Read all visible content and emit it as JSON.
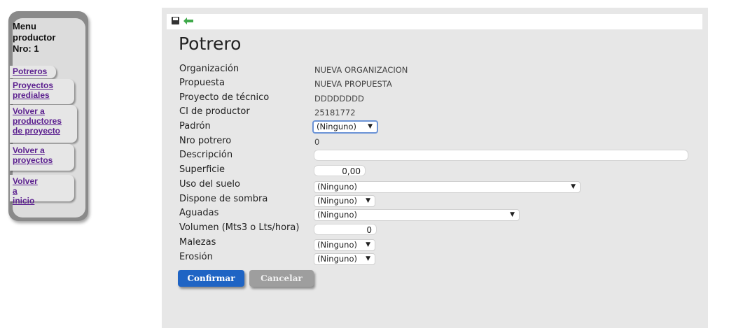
{
  "menu": {
    "title_line1": "Menu",
    "title_line2": "productor",
    "title_line3": "Nro: 1",
    "items": [
      {
        "line1": "Potreros",
        "line2": "",
        "line3": ""
      },
      {
        "line1": "Proyectos",
        "line2": "prediales",
        "line3": ""
      },
      {
        "line1": "Volver a",
        "line2": "productores",
        "line3": "de proyecto"
      },
      {
        "line1": "Volver a",
        "line2": "proyectos",
        "line3": ""
      },
      {
        "line1": "Volver a",
        "line2": "inicio",
        "line3": ""
      }
    ]
  },
  "toolbar": {
    "icons": [
      "save-icon",
      "back-arrow-icon"
    ]
  },
  "page": {
    "title": "Potrero"
  },
  "form": {
    "organizacion": {
      "label": "Organización",
      "value": "NUEVA ORGANIZACION"
    },
    "propuesta": {
      "label": "Propuesta",
      "value": "NUEVA PROPUESTA"
    },
    "proyecto_tecnico": {
      "label": "Proyecto de técnico",
      "value": "DDDDDDDD"
    },
    "ci_productor": {
      "label": "CI de productor",
      "value": "25181772"
    },
    "padron": {
      "label": "Padrón",
      "value": "(Ninguno)"
    },
    "nro_potrero": {
      "label": "Nro potrero",
      "value": "0"
    },
    "descripcion": {
      "label": "Descripción",
      "value": ""
    },
    "superficie": {
      "label": "Superficie",
      "value": "0,00"
    },
    "uso_suelo": {
      "label": "Uso del suelo",
      "value": "(Ninguno)"
    },
    "sombra": {
      "label": "Dispone de sombra",
      "value": "(Ninguno)"
    },
    "aguadas": {
      "label": "Aguadas",
      "value": "(Ninguno)"
    },
    "volumen": {
      "label": "Volumen (Mts3 o Lts/hora)",
      "value": "0"
    },
    "malezas": {
      "label": "Malezas",
      "value": "(Ninguno)"
    },
    "erosion": {
      "label": "Erosión",
      "value": "(Ninguno)"
    }
  },
  "buttons": {
    "confirm": "Confirmar",
    "cancel": "Cancelar"
  },
  "colors": {
    "confirm": "#1f64c4",
    "cancel": "#9e9e9e",
    "link": "#5b1f8f",
    "panel": "#e7e7e7"
  }
}
